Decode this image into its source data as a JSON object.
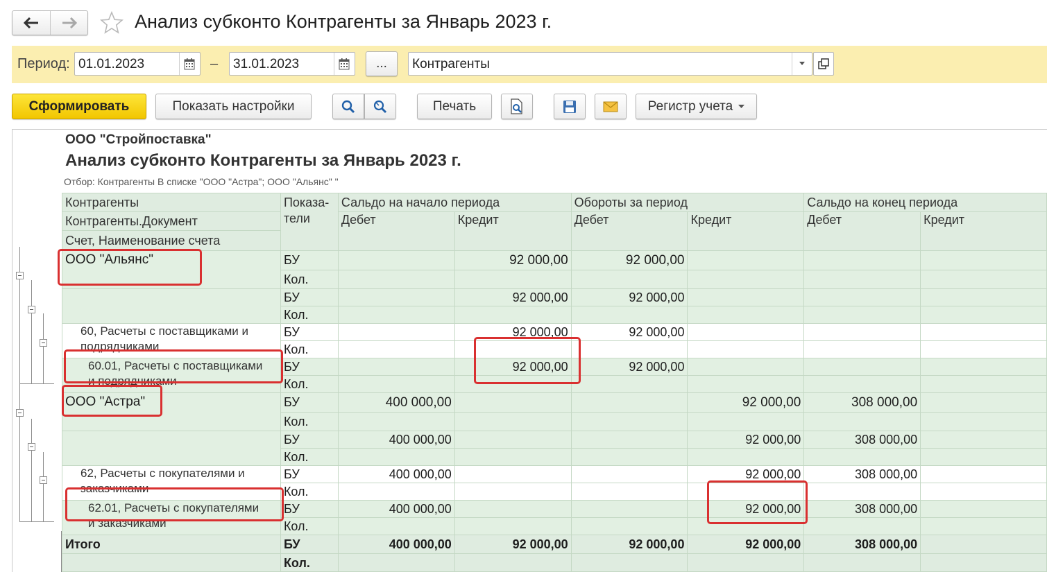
{
  "window": {
    "title": "Анализ субконто Контрагенты за Январь 2023 г."
  },
  "filter_bar": {
    "period_label": "Период:",
    "date_from": "01.01.2023",
    "dash": "–",
    "date_to": "31.01.2023",
    "more_label": "...",
    "subconto_value": "Контрагенты"
  },
  "toolbar": {
    "generate_label": "Сформировать",
    "show_settings_label": "Показать настройки",
    "print_label": "Печать",
    "register_label": "Регистр учета"
  },
  "report": {
    "organization": "ООО \"Стройпоставка\"",
    "title": "Анализ субконто Контрагенты за Январь 2023 г.",
    "filter_text": "Отбор: Контрагенты В списке \"ООО \"Астра\"; ООО \"Альянс\" \"",
    "headers": {
      "row_groups": [
        "Контрагенты",
        "Контрагенты.Документ",
        "Счет, Наименование счета"
      ],
      "indicators_line1": "Показа-",
      "indicators_line2": "тели",
      "opening": "Сальдо на начало периода",
      "turnover": "Обороты за период",
      "closing": "Сальдо на конец периода",
      "debit": "Дебет",
      "credit": "Кредит"
    },
    "rows": [
      {
        "label": "ООО \"Альянс\"",
        "bu": [
          "",
          "92 000,00",
          "92 000,00",
          "",
          "",
          ""
        ],
        "qty": "Кол."
      },
      {
        "label": "",
        "bu": [
          "",
          "92 000,00",
          "92 000,00",
          "",
          "",
          ""
        ],
        "qty": "Кол."
      },
      {
        "label": "60, Расчеты с поставщиками и",
        "label2": "подрядчиками",
        "bu": [
          "",
          "92 000,00",
          "92 000,00",
          "",
          "",
          ""
        ],
        "qty": "Кол."
      },
      {
        "label": "60.01, Расчеты с поставщиками",
        "label2": "и подрядчиками",
        "bu": [
          "",
          "92 000,00",
          "92 000,00",
          "",
          "",
          ""
        ],
        "qty": "Кол."
      },
      {
        "label": "ООО \"Астра\"",
        "bu": [
          "400 000,00",
          "",
          "",
          "92 000,00",
          "308 000,00",
          ""
        ],
        "qty": "Кол."
      },
      {
        "label": "",
        "bu": [
          "400 000,00",
          "",
          "",
          "92 000,00",
          "308 000,00",
          ""
        ],
        "qty": "Кол."
      },
      {
        "label": "62, Расчеты с покупателями и",
        "label2": "заказчиками",
        "bu": [
          "400 000,00",
          "",
          "",
          "92 000,00",
          "308 000,00",
          ""
        ],
        "qty": "Кол."
      },
      {
        "label": "62.01, Расчеты с покупателями",
        "label2": "и заказчиками",
        "bu": [
          "400 000,00",
          "",
          "",
          "92 000,00",
          "308 000,00",
          ""
        ],
        "qty": "Кол."
      }
    ],
    "bu_label": "БУ",
    "total": {
      "label": "Итого",
      "bu": [
        "400 000,00",
        "92 000,00",
        "92 000,00",
        "92 000,00",
        "308 000,00",
        ""
      ],
      "qty": "Кол."
    }
  },
  "colors": {
    "filter_band": "#fbeeb0",
    "primary_button": "#f2c600",
    "table_header": "#dfece0",
    "highlight": "#d93030"
  }
}
